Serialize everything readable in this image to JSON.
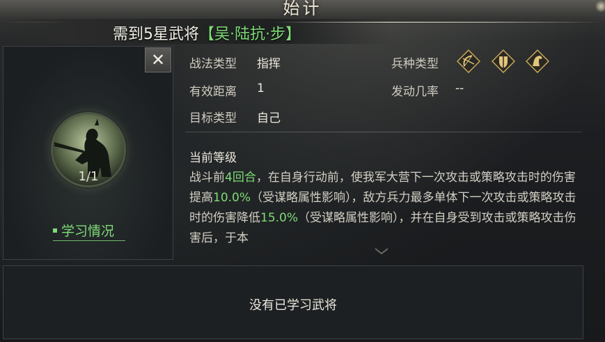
{
  "header": {
    "title": "始计",
    "condition_prefix": "需到5星武将",
    "condition_general": "【吴·陆抗·步】"
  },
  "close_button": {
    "label": "✕"
  },
  "general": {
    "count": "1/1",
    "learn_status_label": "学习情况"
  },
  "info": {
    "tactic_type_label": "战法类型",
    "tactic_type_value": "指挥",
    "range_label": "有效距离",
    "range_value": "1",
    "target_label": "目标类型",
    "target_value": "自己",
    "troop_type_label": "兵种类型",
    "troop_icons": [
      "bow-icon",
      "shield-icon",
      "horse-icon"
    ],
    "trigger_rate_label": "发动几率",
    "trigger_rate_value": "--"
  },
  "level": {
    "title": "当前等级",
    "desc": {
      "p1": "战斗前",
      "g1": "4回合",
      "p2": "，在自身行动前，使我军大营下一次攻击或策略攻击时的伤害提高",
      "g2": "10.0%",
      "p3": "（受谋略属性影响），敌方兵力最多单体下一次攻击或策略攻击时的伤害降低",
      "g3": "15.0%",
      "p4": "（受谋略属性影响），并在自身受到攻击或策略攻击伤害后，于本"
    }
  },
  "learned": {
    "empty_text": "没有已学习武将"
  },
  "colors": {
    "highlight_green": "#7fdc77",
    "text_light": "#ece8dc",
    "gold_icon": "#c9a95a"
  }
}
